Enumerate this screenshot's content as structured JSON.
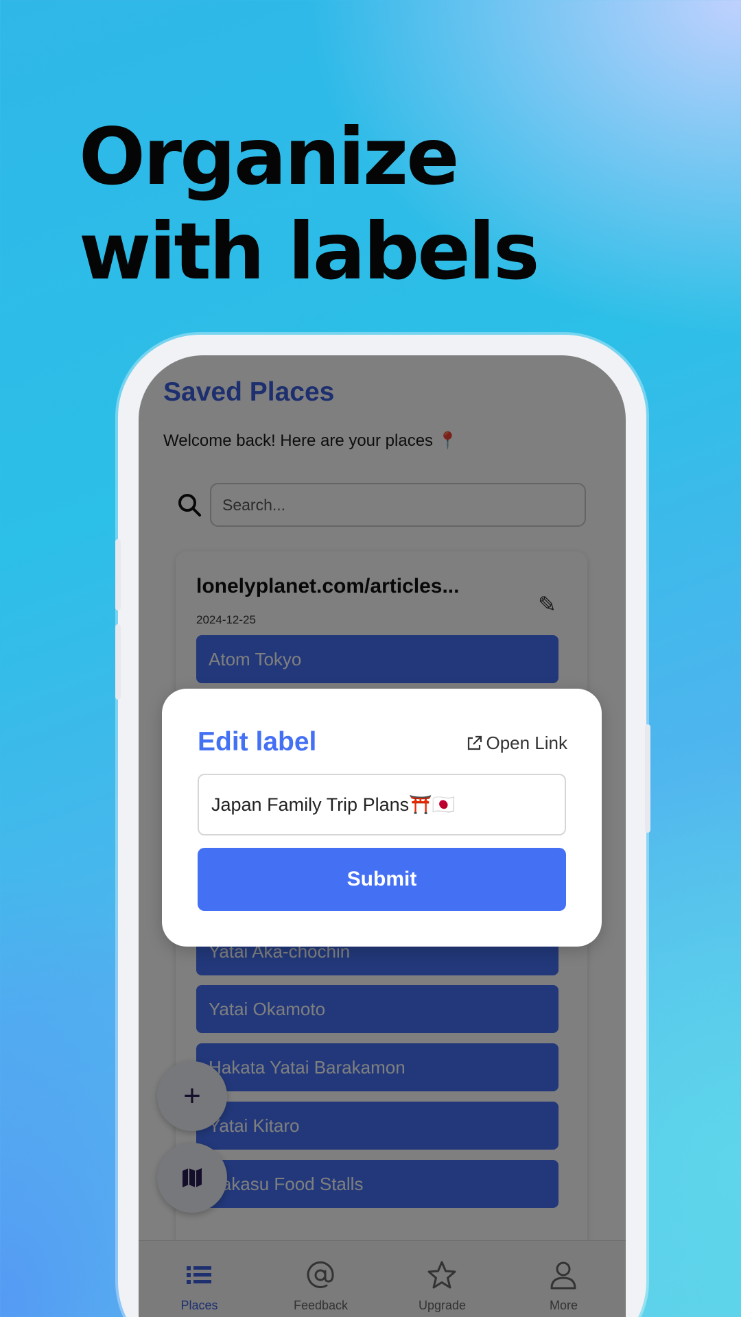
{
  "headline": {
    "line1": "Organize",
    "line2": "with labels"
  },
  "app": {
    "title": "Saved Places",
    "welcome": "Welcome back! Here are your places 📍",
    "search": {
      "placeholder": "Search...",
      "icon": "search-icon"
    },
    "card": {
      "title": "lonelyplanet.com/articles...",
      "date": "2024-12-25",
      "edit_icon": "✎",
      "places": [
        "Atom Tokyo",
        "Yatai Aka-chochin",
        "Yatai Okamoto",
        "Hakata Yatai Barakamon",
        "Yatai Kitaro",
        "Nakasu Food Stalls"
      ]
    },
    "fabs": {
      "add_label": "+",
      "map_icon": "map-icon"
    },
    "bottom_nav": [
      {
        "label": "Places",
        "icon": "list-icon",
        "active": true
      },
      {
        "label": "Feedback",
        "icon": "at-icon",
        "active": false
      },
      {
        "label": "Upgrade",
        "icon": "star-icon",
        "active": false
      },
      {
        "label": "More",
        "icon": "person-icon",
        "active": false
      }
    ]
  },
  "dialog": {
    "title": "Edit label",
    "open_link": "Open Link",
    "input_value": "Japan Family Trip Plans⛩️🇯🇵",
    "submit": "Submit"
  },
  "colors": {
    "accent": "#4470f4",
    "title_blue": "#3b5fdc",
    "headline": "#050505"
  }
}
